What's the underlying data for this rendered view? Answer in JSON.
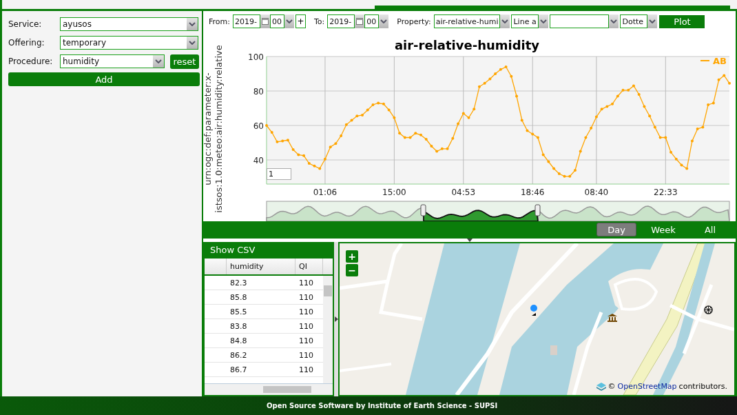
{
  "form": {
    "fields": [
      {
        "label": "Service:",
        "value": "ayusos"
      },
      {
        "label": "Offering:",
        "value": "temporary"
      },
      {
        "label": "Procedure:",
        "value": "humidity"
      }
    ],
    "reset_button": "reset",
    "add_button": "Add"
  },
  "toolbar": {
    "from_label": "From:",
    "from_date": "2019-",
    "from_hour": "00",
    "plus_button": "+",
    "to_label": "To:",
    "to_date": "2019-",
    "to_hour": "00",
    "property_label": "Property:",
    "property": "air-relative-humi",
    "chart_type": "Line a",
    "line_style": "Dotte",
    "plot_button": "Plot"
  },
  "chart": {
    "point_input": "1",
    "chart_data": {
      "type": "line",
      "title": "air-relative-humidity",
      "ylabel": "urn:ogc:def:parameter:x-istsos:1.0:meteo:air:humidity:relative",
      "grid": true,
      "categories": [
        null,
        null,
        null,
        null,
        null,
        null,
        null,
        null,
        null,
        null,
        null,
        "01:06",
        null,
        null,
        null,
        null,
        null,
        null,
        null,
        null,
        null,
        null,
        null,
        null,
        "15:00",
        null,
        null,
        null,
        null,
        null,
        null,
        null,
        null,
        null,
        null,
        null,
        null,
        "04:53",
        null,
        null,
        null,
        null,
        null,
        null,
        null,
        null,
        null,
        null,
        null,
        null,
        "18:46",
        null,
        null,
        null,
        null,
        null,
        null,
        null,
        null,
        null,
        null,
        null,
        "08:40",
        null,
        null,
        null,
        null,
        null,
        null,
        null,
        null,
        null,
        null,
        null,
        null,
        "22:33",
        null,
        null,
        null,
        null,
        null,
        null,
        null,
        null,
        null,
        null,
        null,
        null
      ],
      "ylim": [
        26,
        100
      ],
      "yticks": [
        40,
        60,
        80,
        100
      ],
      "series": [
        {
          "name": "AB",
          "color": "#ffa500",
          "values": [
            60,
            56,
            50.5,
            51,
            51.5,
            46,
            43,
            42.5,
            38,
            36.5,
            35,
            40.5,
            47.5,
            49.5,
            54,
            60.5,
            63,
            65.5,
            66,
            69,
            72,
            73,
            72.5,
            69,
            64.5,
            55.5,
            53,
            53,
            55.5,
            54.5,
            52,
            48,
            45,
            46.5,
            46.5,
            52.5,
            61,
            67,
            64.5,
            69.5,
            82.5,
            84.5,
            87,
            90,
            92.5,
            94,
            88.5,
            77,
            63,
            57,
            55,
            53,
            43,
            39,
            35,
            32,
            30.5,
            30.5,
            34,
            45,
            53,
            58.5,
            65,
            69.5,
            71,
            72.5,
            77,
            80.5,
            80.5,
            83,
            78,
            71,
            65.5,
            59,
            53,
            53,
            44.5,
            40.5,
            37,
            35,
            51,
            58,
            59,
            72,
            73,
            86.5,
            89,
            84.5
          ]
        }
      ]
    }
  },
  "ranges": [
    {
      "label": "Day",
      "selected": true
    },
    {
      "label": "Week",
      "selected": false
    },
    {
      "label": "All",
      "selected": false
    }
  ],
  "csv": {
    "title": "Show CSV",
    "columns": [
      "humidity",
      "QI"
    ],
    "rows": [
      [
        "82.3",
        "110"
      ],
      [
        "85.8",
        "110"
      ],
      [
        "85.5",
        "110"
      ],
      [
        "83.8",
        "110"
      ],
      [
        "84.8",
        "110"
      ],
      [
        "86.2",
        "110"
      ],
      [
        "86.7",
        "110"
      ]
    ]
  },
  "map": {
    "kind": "picture",
    "zoom_in": "+",
    "zoom_out": "−",
    "attribution_prefix": "©",
    "attribution_link": "OpenStreetMap",
    "attribution_suffix": "contributors."
  },
  "footer": "Open Source Software by Institute of Earth Science - SUPSI"
}
